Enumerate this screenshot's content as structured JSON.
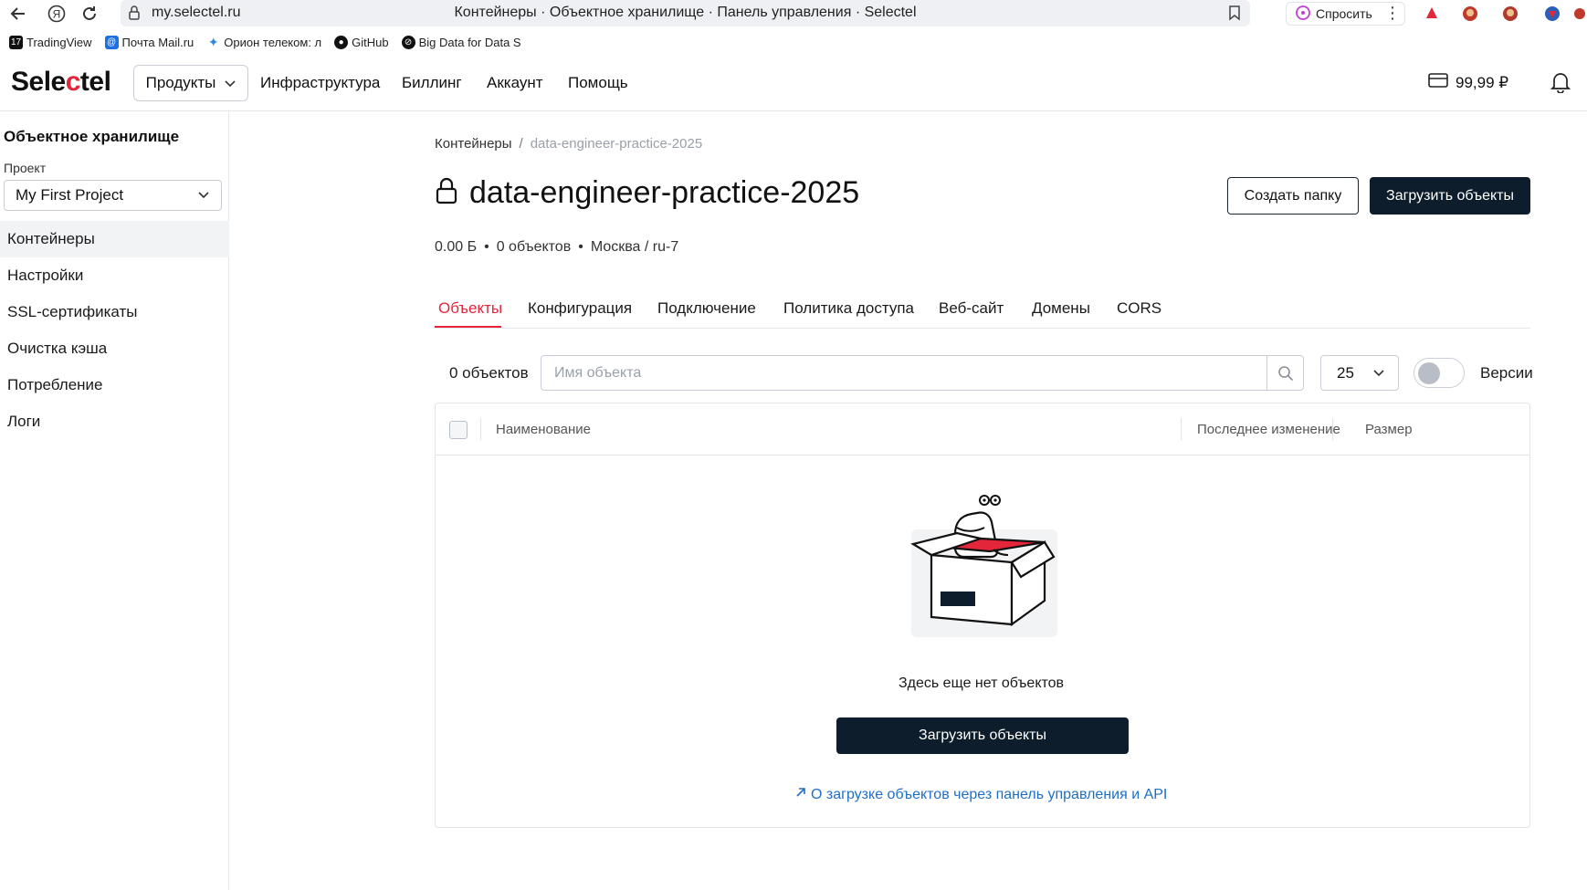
{
  "browser": {
    "url": "my.selectel.ru",
    "tab_title": "Контейнеры · Объектное хранилище · Панель управления · Selectel",
    "ask_label": "Спросить",
    "bookmarks": [
      {
        "label": "TradingView",
        "icon": "tradingview-icon"
      },
      {
        "label": "Почта Mail.ru",
        "icon": "mail-icon"
      },
      {
        "label": "Орион телеком: л",
        "icon": "orion-icon"
      },
      {
        "label": "GitHub",
        "icon": "github-icon"
      },
      {
        "label": "Big Data for Data S",
        "icon": "bigdata-icon"
      }
    ]
  },
  "header": {
    "logo": {
      "part1": "Sele",
      "part2": "c",
      "part3": "tel"
    },
    "products_label": "Продукты",
    "nav": [
      "Инфраструктура",
      "Биллинг",
      "Аккаунт",
      "Помощь"
    ],
    "balance": "99,99 ₽"
  },
  "sidebar": {
    "title": "Объектное хранилище",
    "project_label": "Проект",
    "project_value": "My First Project",
    "items": [
      {
        "label": "Контейнеры",
        "active": true
      },
      {
        "label": "Настройки",
        "active": false
      },
      {
        "label": "SSL-сертификаты",
        "active": false
      },
      {
        "label": "Очистка кэша",
        "active": false
      },
      {
        "label": "Потребление",
        "active": false
      },
      {
        "label": "Логи",
        "active": false
      }
    ]
  },
  "main": {
    "breadcrumb": {
      "root": "Контейнеры",
      "separator": "/",
      "current": "data-engineer-practice-2025"
    },
    "title": "data-engineer-practice-2025",
    "create_folder_label": "Создать папку",
    "upload_label": "Загрузить объекты",
    "meta": {
      "size": "0.00 Б",
      "objects": "0 объектов",
      "region": "Москва / ru-7",
      "dot": "•"
    },
    "tabs": [
      "Объекты",
      "Конфигурация",
      "Подключение",
      "Политика доступа",
      "Веб-сайт",
      "Домены",
      "CORS"
    ],
    "active_tab": "Объекты",
    "toolbar": {
      "count_label": "0 объектов",
      "search_placeholder": "Имя объекта",
      "per_page": "25",
      "versions_label": "Версии",
      "versions_enabled": false
    },
    "table": {
      "columns": [
        "Наименование",
        "Последнее изменение",
        "Размер"
      ]
    },
    "empty": {
      "text": "Здесь еще нет объектов",
      "upload_label": "Загрузить объекты",
      "docs_link": "О загрузке объектов через панель управления и API"
    }
  },
  "colors": {
    "accent": "#e4263b",
    "primary": "#0e1d2b",
    "link": "#1f6fc5"
  }
}
